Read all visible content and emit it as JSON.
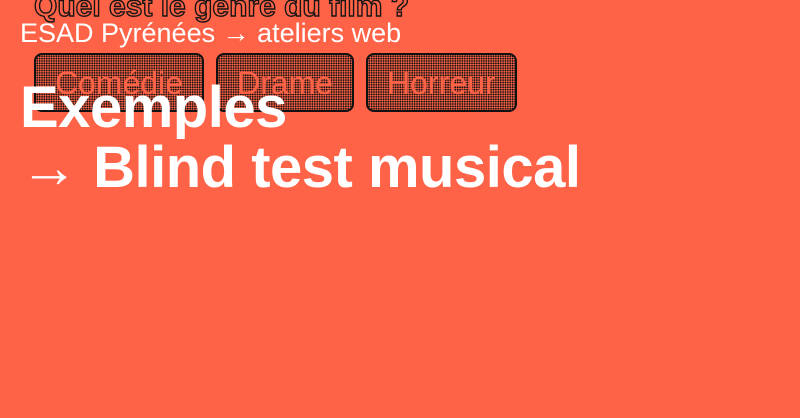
{
  "colors": {
    "background": "#ff6347",
    "overlay_text": "#ffffff",
    "dots": "#111111"
  },
  "example": {
    "question": "Quel est le genre du film ?",
    "choices": [
      {
        "label": "Comédie"
      },
      {
        "label": "Drame"
      },
      {
        "label": "Horreur"
      }
    ]
  },
  "header": {
    "breadcrumb": "ESAD Pyrénées → ateliers web"
  },
  "title": {
    "line1": "Exemples",
    "line2": "→ Blind test musical"
  }
}
